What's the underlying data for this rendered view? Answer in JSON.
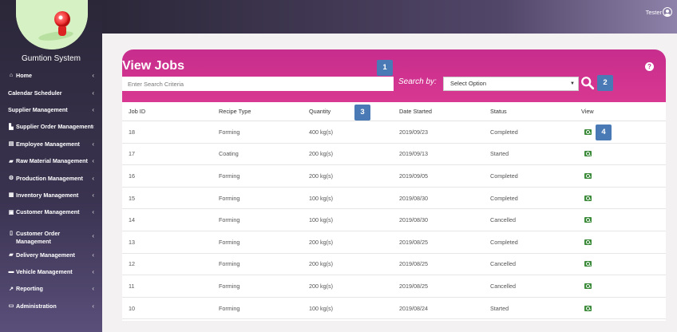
{
  "sidebar": {
    "system_name": "Gumtion System",
    "items": [
      {
        "icon": "home-icon",
        "glyph": "⌂",
        "label": "Home"
      },
      {
        "icon": "",
        "glyph": "",
        "label": "Calendar Scheduler"
      },
      {
        "icon": "",
        "glyph": "",
        "label": "Supplier Management"
      },
      {
        "icon": "cart-icon",
        "glyph": "▙",
        "label": "Supplier Order Management"
      },
      {
        "icon": "id-card-icon",
        "glyph": "▤",
        "label": "Employee Management"
      },
      {
        "icon": "truck-icon",
        "glyph": "▰",
        "label": "Raw Material Management"
      },
      {
        "icon": "cogs-icon",
        "glyph": "⚙",
        "label": "Production Management"
      },
      {
        "icon": "list-icon",
        "glyph": "▦",
        "label": "Inventory Management"
      },
      {
        "icon": "user-card-icon",
        "glyph": "▣",
        "label": "Customer Management"
      },
      {
        "icon": "file-icon",
        "glyph": "▯",
        "label": "Customer Order Management"
      },
      {
        "icon": "delivery-truck-icon",
        "glyph": "▰",
        "label": "Delivery Management"
      },
      {
        "icon": "car-icon",
        "glyph": "▬",
        "label": "Vehicle Management"
      },
      {
        "icon": "chart-icon",
        "glyph": "↗",
        "label": "Reporting"
      },
      {
        "icon": "laptop-icon",
        "glyph": "▭",
        "label": "Administration"
      }
    ]
  },
  "header": {
    "user_name": "Tester"
  },
  "page": {
    "title": "View Jobs",
    "search_placeholder": "Enter Search Criteria",
    "search_by_label": "Search by:",
    "select_value": "Select Option",
    "help_label": "?"
  },
  "badges": [
    "1",
    "2",
    "3",
    "4"
  ],
  "table": {
    "columns": [
      "Job ID",
      "Recipe Type",
      "Quantity",
      "Date Started",
      "Status",
      "View"
    ],
    "rows": [
      {
        "id": "18",
        "recipe": "Forming",
        "qty": "400 kg(s)",
        "date": "2019/09/23",
        "status": "Completed"
      },
      {
        "id": "17",
        "recipe": "Coating",
        "qty": "200 kg(s)",
        "date": "2019/09/13",
        "status": "Started"
      },
      {
        "id": "16",
        "recipe": "Forming",
        "qty": "200 kg(s)",
        "date": "2019/09/05",
        "status": "Completed"
      },
      {
        "id": "15",
        "recipe": "Forming",
        "qty": "100 kg(s)",
        "date": "2019/08/30",
        "status": "Completed"
      },
      {
        "id": "14",
        "recipe": "Forming",
        "qty": "100 kg(s)",
        "date": "2019/08/30",
        "status": "Cancelled"
      },
      {
        "id": "13",
        "recipe": "Forming",
        "qty": "200 kg(s)",
        "date": "2019/08/25",
        "status": "Completed"
      },
      {
        "id": "12",
        "recipe": "Forming",
        "qty": "200 kg(s)",
        "date": "2019/08/25",
        "status": "Cancelled"
      },
      {
        "id": "11",
        "recipe": "Forming",
        "qty": "200 kg(s)",
        "date": "2019/08/25",
        "status": "Cancelled"
      },
      {
        "id": "10",
        "recipe": "Forming",
        "qty": "100 kg(s)",
        "date": "2019/08/24",
        "status": "Started"
      }
    ]
  },
  "colors": {
    "accent": "#d02f8f",
    "sidebar": "#2b2738",
    "view_button": "#3a8a3a",
    "badge": "#4a7ab5"
  }
}
